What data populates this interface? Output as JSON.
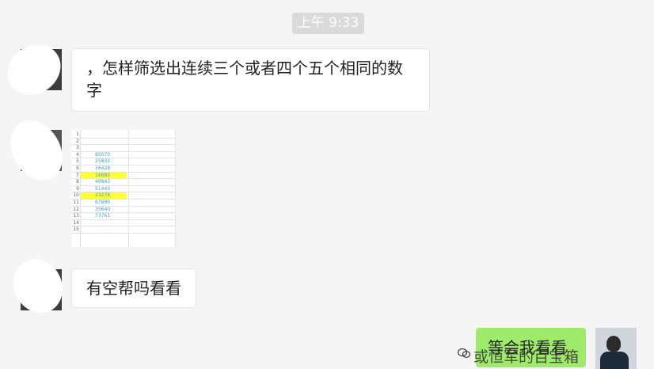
{
  "chat": {
    "timestamp": "上午 9:33",
    "messages": [
      {
        "text": "，怎样筛选出连续三个或者四个五个相同的数字",
        "line1": "，怎样筛选出连续三个或者四个五个相同的数",
        "line2": "字"
      },
      {
        "text": "有空帮吗看看"
      },
      {
        "text": "等会我看看"
      }
    ],
    "spreadsheet": {
      "row_numbers": [
        "1",
        "2",
        "3",
        "4",
        "5",
        "6",
        "7",
        "8",
        "9",
        "10",
        "11",
        "12",
        "13",
        "14",
        "15"
      ],
      "values": [
        "",
        "",
        "",
        "85070",
        "25833",
        "16428",
        "16683",
        "46843",
        "51443",
        "23278",
        "67690",
        "35640",
        "73761",
        "",
        ""
      ],
      "highlighted_rows": [
        7,
        10
      ]
    },
    "watermark": "或恒军的百宝箱"
  },
  "colors": {
    "background": "#f5f5f5",
    "my_bubble": "#9eea6a",
    "highlight": "#ffff3a"
  }
}
